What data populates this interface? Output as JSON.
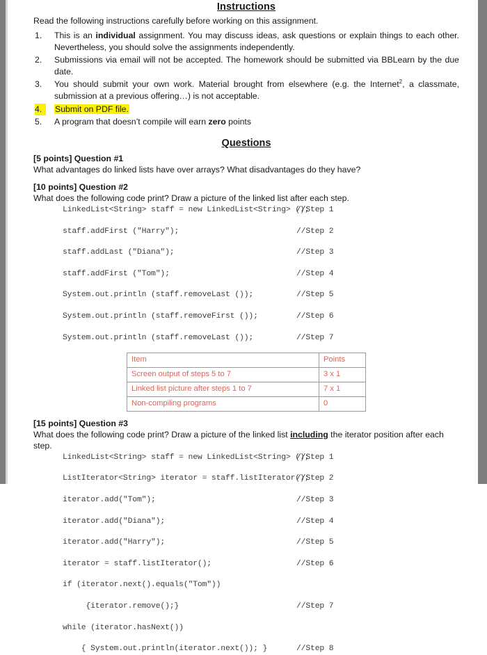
{
  "document": {
    "instructions": {
      "heading": "Instructions",
      "lead": "Read the following instructions carefully before working on this assignment.",
      "items": [
        {
          "n": "1.",
          "pre": "This is an ",
          "bold": "individual",
          "post": " assignment. You may discuss ideas, ask questions or explain things to each other. Nevertheless, you should solve the assignments independently."
        },
        {
          "n": "2.",
          "text": "Submissions via email will not be accepted. The homework should be submitted via BBLearn by the due date."
        },
        {
          "n": "3.",
          "pre": "You should submit your own work. Material brought from elsewhere (e.g. the Internet",
          "sup": "2",
          "post": ", a classmate, submission at a previous offering…) is not acceptable."
        },
        {
          "n": "4.",
          "text": "Submit on PDF file.",
          "highlight_color": "#fcf003"
        },
        {
          "n": "5.",
          "pre": "A program that doesn’t compile will earn ",
          "bold": "zero",
          "post": " points"
        }
      ]
    },
    "questions": {
      "heading": "Questions",
      "q1": {
        "title": "[5 points] Question #1",
        "body": "What advantages do linked lists have over arrays? What disadvantages do they have?"
      },
      "q2": {
        "title": "[10 points] Question #2",
        "body": "What does the following code print? Draw a picture of the linked list after each step.",
        "code": [
          {
            "src": "LinkedList<String> staff = new LinkedList<String> ();",
            "note": "//Step 1"
          },
          {
            "src": "staff.addFirst (\"Harry\");",
            "note": "//Step 2"
          },
          {
            "src": "staff.addLast (\"Diana\");",
            "note": "//Step 3"
          },
          {
            "src": "staff.addFirst (\"Tom\");",
            "note": "//Step 4"
          },
          {
            "src": "System.out.println (staff.removeLast ());",
            "note": "//Step 5"
          },
          {
            "src": "System.out.println (staff.removeFirst ());",
            "note": "//Step 6"
          },
          {
            "src": "System.out.println (staff.removeLast ());",
            "note": "//Step 7"
          }
        ],
        "rubric": {
          "text_color": "#d9665c",
          "border_color": "#9a9a9a",
          "headers": [
            "Item",
            "Points"
          ],
          "rows": [
            [
              "Screen output of steps 5 to 7",
              "3 x 1"
            ],
            [
              "Linked list picture after steps 1 to 7",
              "7 x 1"
            ],
            [
              "Non-compiling programs",
              "0"
            ]
          ]
        }
      },
      "q3": {
        "title": "[15 points] Question #3",
        "body_pre": "What does the following code print? Draw a picture of the linked list ",
        "body_emph": "including",
        "body_post": " the iterator position after each step.",
        "code": [
          {
            "src": "LinkedList<String> staff = new LinkedList<String> ();",
            "note": "//Step 1"
          },
          {
            "src": "ListIterator<String> iterator = staff.listIterator();",
            "note": "//Step 2"
          },
          {
            "src": "iterator.add(\"Tom\");",
            "note": "//Step 3"
          },
          {
            "src": "iterator.add(\"Diana\");",
            "note": "//Step 4"
          },
          {
            "src": "iterator.add(\"Harry\");",
            "note": "//Step 5"
          },
          {
            "src": "iterator = staff.listIterator();",
            "note": "//Step 6"
          },
          {
            "src": "if (iterator.next().equals(\"Tom\"))",
            "note": ""
          },
          {
            "src": "     {iterator.remove();}",
            "note": "//Step 7"
          },
          {
            "src": "while (iterator.hasNext())",
            "note": ""
          },
          {
            "src": "    { System.out.println(iterator.next()); }",
            "note": "//Step 8"
          }
        ]
      }
    }
  }
}
